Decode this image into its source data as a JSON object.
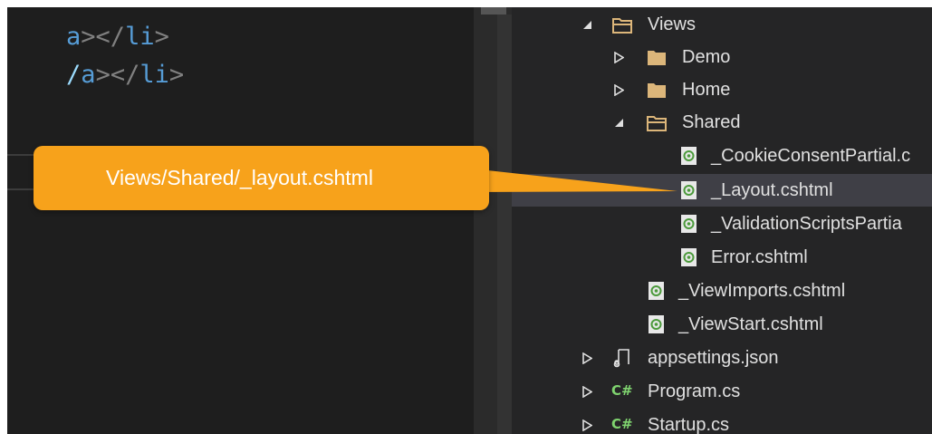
{
  "editor": {
    "lines": [
      {
        "slash": "",
        "tag": "a",
        "br1": "></",
        "tag2": "li",
        "br2": ">"
      },
      {
        "slash": "/",
        "tag": "a",
        "br1": "></",
        "tag2": "li",
        "br2": ">"
      }
    ]
  },
  "callout": {
    "text": "Views/Shared/_layout.cshtml",
    "color": "#f7a21b"
  },
  "explorer": {
    "items": [
      {
        "label": "Views",
        "type": "folder-open",
        "expander": "expanded"
      },
      {
        "label": "Demo",
        "type": "folder",
        "expander": "collapsed"
      },
      {
        "label": "Home",
        "type": "folder",
        "expander": "collapsed"
      },
      {
        "label": "Shared",
        "type": "folder-open",
        "expander": "expanded"
      },
      {
        "label": "_CookieConsentPartial.c",
        "type": "razor-file"
      },
      {
        "label": "_Layout.cshtml",
        "type": "razor-file",
        "selected": true
      },
      {
        "label": "_ValidationScriptsPartia",
        "type": "razor-file"
      },
      {
        "label": "Error.cshtml",
        "type": "razor-file"
      },
      {
        "label": "_ViewImports.cshtml",
        "type": "razor-file"
      },
      {
        "label": "_ViewStart.cshtml",
        "type": "razor-file"
      },
      {
        "label": "appsettings.json",
        "type": "json-file",
        "expander": "collapsed"
      },
      {
        "label": "Program.cs",
        "type": "csharp-file",
        "icon_text": "C#",
        "expander": "collapsed"
      },
      {
        "label": "Startup.cs",
        "type": "csharp-file",
        "icon_text": "C#",
        "expander": "collapsed"
      }
    ]
  },
  "colors": {
    "editor_bg": "#1e1e1e",
    "explorer_bg": "#252526",
    "folder": "#dcb67a",
    "razor_icon": "#7fbf6f",
    "csharp_icon": "#7fd36f",
    "selection": "#3f3f46"
  }
}
